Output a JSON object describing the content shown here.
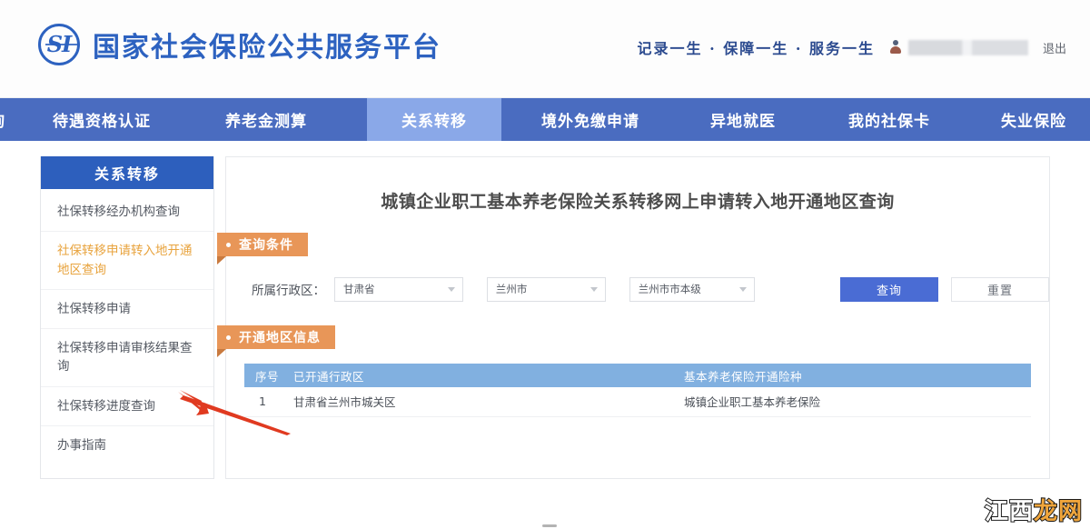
{
  "header": {
    "logo_text": "SI",
    "brand_title": "国家社会保险公共服务平台",
    "tagline": "记录一生 · 保障一生 · 服务一生",
    "username_masked": "",
    "logout_label": "退出"
  },
  "nav": {
    "partial_left_label": "询",
    "items": [
      {
        "label": "待遇资格认证",
        "active": false
      },
      {
        "label": "养老金测算",
        "active": false
      },
      {
        "label": "关系转移",
        "active": true
      },
      {
        "label": "境外免缴申请",
        "active": false
      },
      {
        "label": "异地就医",
        "active": false
      },
      {
        "label": "我的社保卡",
        "active": false
      },
      {
        "label": "失业保险",
        "active": false
      }
    ]
  },
  "sidebar": {
    "title": "关系转移",
    "items": [
      {
        "label": "社保转移经办机构查询",
        "active": false
      },
      {
        "label": "社保转移申请转入地开通地区查询",
        "active": true
      },
      {
        "label": "社保转移申请",
        "active": false
      },
      {
        "label": "社保转移申请审核结果查询",
        "active": false
      },
      {
        "label": "社保转移进度查询",
        "active": false
      },
      {
        "label": "办事指南",
        "active": false
      }
    ]
  },
  "main": {
    "page_title": "城镇企业职工基本养老保险关系转移网上申请转入地开通地区查询",
    "query_section": {
      "ribbon_label": "查询条件",
      "field_label": "所属行政区：",
      "province_value": "甘肃省",
      "city_value": "兰州市",
      "district_value": "兰州市市本级",
      "query_button": "查询",
      "reset_button": "重置"
    },
    "result_section": {
      "ribbon_label": "开通地区信息",
      "columns": [
        "序号",
        "已开通行政区",
        "基本养老保险开通险种"
      ],
      "rows": [
        {
          "index": "1",
          "area": "甘肃省兰州市城关区",
          "insurance": "城镇企业职工基本养老保险"
        }
      ]
    }
  },
  "watermark": {
    "text_white": "江西",
    "text_orange": "龙网"
  },
  "colors": {
    "brand_blue": "#2d62c0",
    "nav_blue": "#4a6cc0",
    "nav_active_blue": "#8aa8e8",
    "sidebar_head_blue": "#2d5fbd",
    "sidebar_active_orange": "#e8a33d",
    "ribbon_orange": "#e89658",
    "table_head_blue": "#81b0e0",
    "primary_button_blue": "#4a6cd4",
    "annotation_red": "#e03a20"
  }
}
